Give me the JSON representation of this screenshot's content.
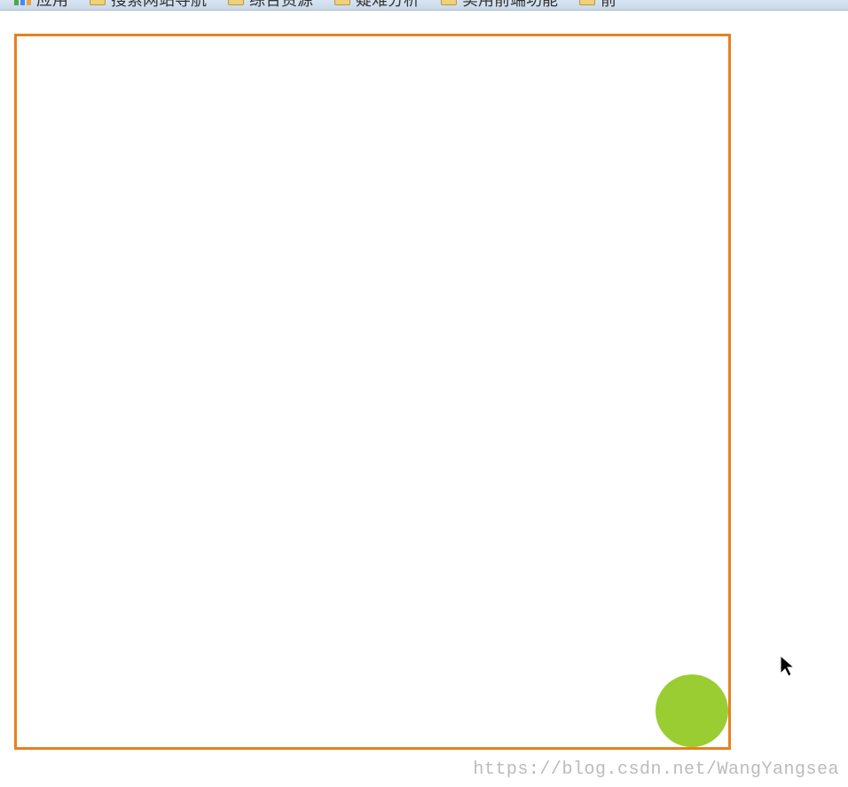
{
  "bookmarks": [
    {
      "label": "应用",
      "type": "logo"
    },
    {
      "label": "搜索网站导航",
      "type": "folder"
    },
    {
      "label": "综合资源",
      "type": "folder"
    },
    {
      "label": "疑难分析",
      "type": "folder"
    },
    {
      "label": "实用前端功能",
      "type": "folder"
    },
    {
      "label": "前",
      "type": "folder"
    }
  ],
  "canvas": {
    "ball_color": "#9acd32",
    "border_color": "#e88020"
  },
  "watermark": "https://blog.csdn.net/WangYangsea"
}
